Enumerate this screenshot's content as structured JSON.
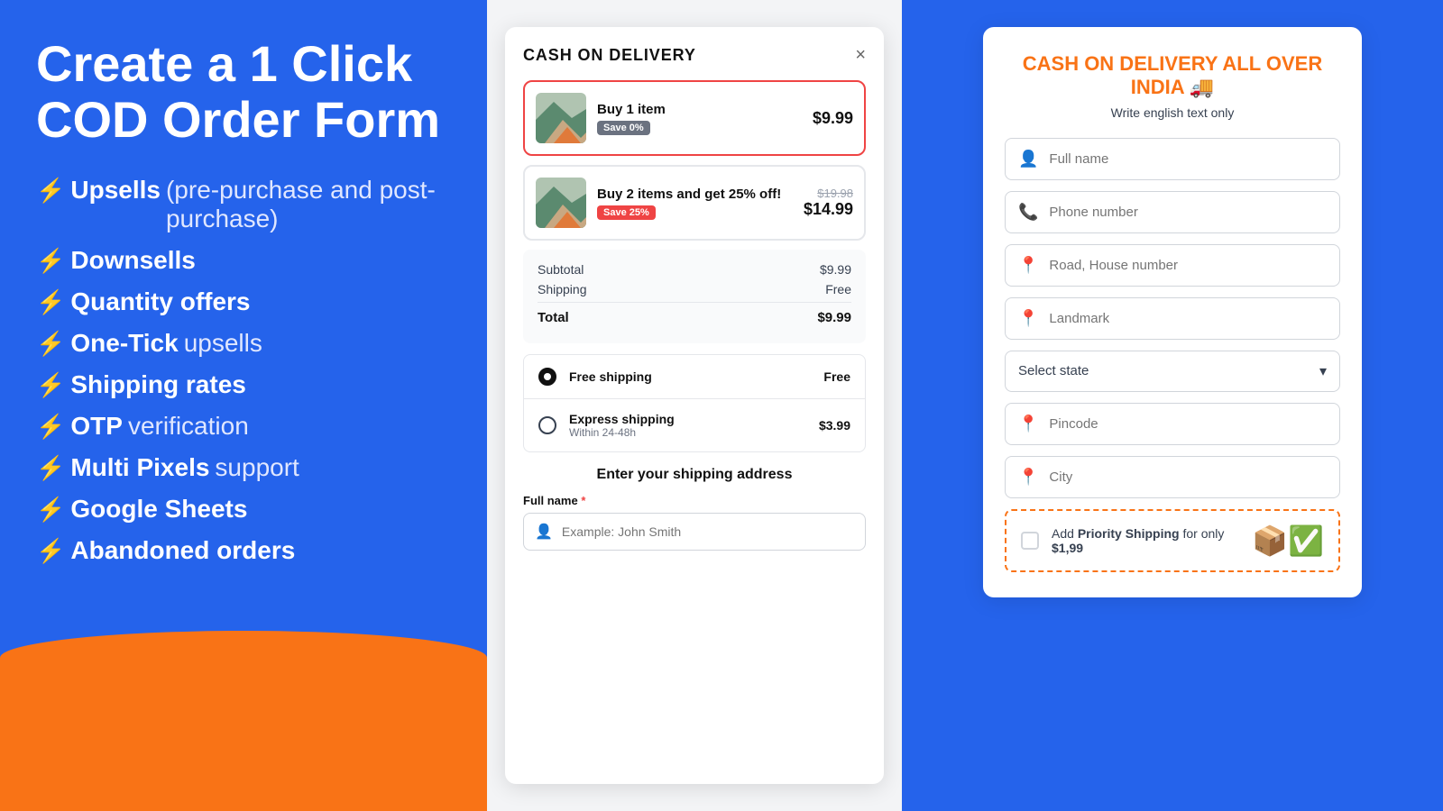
{
  "left": {
    "title": "Create a 1 Click COD Order Form",
    "features": [
      {
        "bolt": "⚡",
        "highlight": "Upsells",
        "normal": "(pre-purchase and post-purchase)"
      },
      {
        "bolt": "⚡",
        "highlight": "Downsells",
        "normal": ""
      },
      {
        "bolt": "⚡",
        "highlight": "Quantity offers",
        "normal": ""
      },
      {
        "bolt": "⚡",
        "highlight": "One-Tick",
        "normal": "upsells"
      },
      {
        "bolt": "⚡",
        "highlight": "Shipping rates",
        "normal": ""
      },
      {
        "bolt": "⚡",
        "highlight": "OTP",
        "normal": "verification"
      },
      {
        "bolt": "⚡",
        "highlight": "Multi Pixels",
        "normal": "support"
      },
      {
        "bolt": "⚡",
        "highlight": "Google Sheets",
        "normal": ""
      },
      {
        "bolt": "⚡",
        "highlight": "Abandoned orders",
        "normal": ""
      }
    ]
  },
  "middle": {
    "modal_title": "CASH ON DELIVERY",
    "close_label": "×",
    "products": [
      {
        "label": "Buy 1 item",
        "badge": "Save 0%",
        "badge_type": "gray",
        "price": "$9.99",
        "original_price": "",
        "selected": true
      },
      {
        "label": "Buy 2 items and get 25% off!",
        "badge": "Save 25%",
        "badge_type": "orange",
        "price": "$14.99",
        "original_price": "$19.98",
        "selected": false
      }
    ],
    "summary": {
      "subtotal_label": "Subtotal",
      "subtotal_value": "$9.99",
      "shipping_label": "Shipping",
      "shipping_value": "Free",
      "total_label": "Total",
      "total_value": "$9.99"
    },
    "shipping_options": [
      {
        "name": "Free shipping",
        "sub": "",
        "price": "Free",
        "selected": true
      },
      {
        "name": "Express shipping",
        "sub": "Within 24-48h",
        "price": "$3.99",
        "selected": false
      }
    ],
    "address_title": "Enter your shipping address",
    "form": {
      "full_name_label": "Full name",
      "full_name_required": true,
      "full_name_placeholder": "Example: John Smith"
    }
  },
  "right": {
    "title": "CASH ON DELIVERY ALL OVER INDIA 🚚",
    "subtitle": "Write english text only",
    "fields": [
      {
        "icon": "👤",
        "placeholder": "Full name",
        "type": "text"
      },
      {
        "icon": "📞",
        "placeholder": "Phone number",
        "type": "tel"
      },
      {
        "icon": "📍",
        "placeholder": "Road, House number",
        "type": "text"
      },
      {
        "icon": "📍",
        "placeholder": "Landmark",
        "type": "text"
      }
    ],
    "state_select": "Select state",
    "fields2": [
      {
        "icon": "📍",
        "placeholder": "Pincode",
        "type": "text"
      },
      {
        "icon": "📍",
        "placeholder": "City",
        "type": "text"
      }
    ],
    "priority": {
      "text_pre": "Add ",
      "text_bold": "Priority Shipping",
      "text_post": " for only ",
      "price": "$1,99",
      "icon": "📦"
    }
  }
}
